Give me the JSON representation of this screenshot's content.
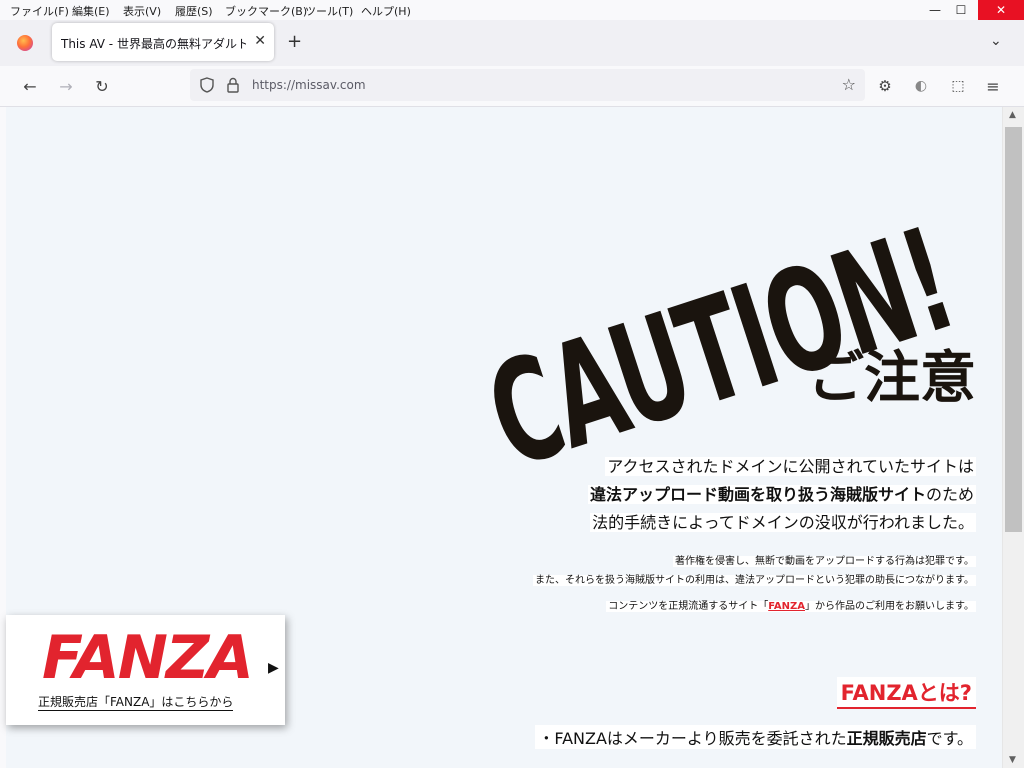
{
  "menu": [
    "ファイル(F)",
    "編集(E)",
    "表示(V)",
    "履歴(S)",
    "ブックマーク(B)",
    "ツール(T)",
    "ヘルプ(H)"
  ],
  "tab": {
    "title": "This AV - 世界最高の無料アダルト エ",
    "close": "✕",
    "new": "+"
  },
  "url": "https://missav.com",
  "page": {
    "caution": "CAUTION!",
    "chui": "ご注意",
    "lead1": "アクセスされたドメインに公開されていたサイトは",
    "lead2a": "違法アップロード動画を取り扱う海賊版サイト",
    "lead2b": "のため",
    "lead3": "法的手続きによってドメインの没収が行われました。",
    "small1": "著作権を侵害し、無断で動画をアップロードする行為は犯罪です。",
    "small2": "また、それらを扱う海賊版サイトの利用は、違法アップロードという犯罪の助長につながります。",
    "small3a": "コンテンツを正規流通するサイト「",
    "small3b": "FANZA",
    "small3c": "」から作品のご利用をお願いします。",
    "fanza_heading": "FANZAとは?",
    "bullet_a": "・FANZAはメーカーより販売を委託された",
    "bullet_b": "正規販売店",
    "bullet_c": "です。"
  },
  "banner": {
    "logo": "FANZA",
    "caption": "正規販売店「FANZA」はこちらから"
  },
  "colors": {
    "accent": "#e2242e",
    "caution": "#1a140e",
    "page_bg": "#f2f6fa"
  }
}
